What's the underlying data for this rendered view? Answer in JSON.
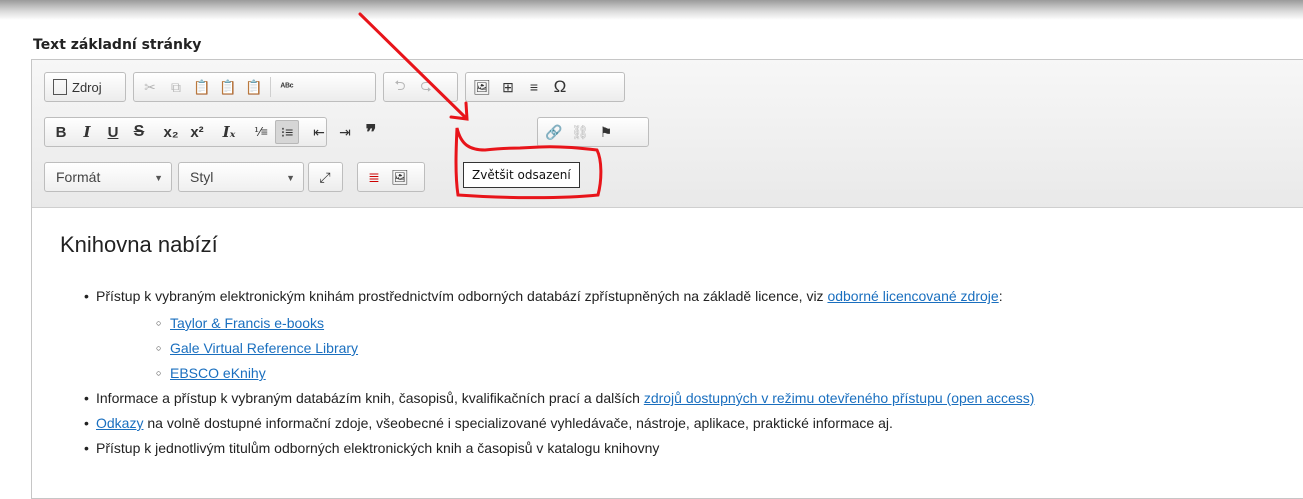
{
  "field_label": "Text základní stránky",
  "toolbar": {
    "source_label": "Zdroj",
    "format_combo": "Formát",
    "style_combo": "Styl",
    "tooltip": "Zvětšit odsazení"
  },
  "content": {
    "heading": "Knihovna nabízí",
    "items": [
      {
        "text": "Přístup k vybraným elektronickým knihám prostřednictvím odborných databází zpřístupněných na základě licence, viz ",
        "link": "odborné licencované zdroje",
        "suffix": ":",
        "sub": [
          "Taylor & Francis e-books",
          "Gale Virtual Reference Library",
          "EBSCO eKnihy"
        ]
      },
      {
        "text": "Informace a přístup k vybraným databázím knih, časopisů, kvalifikačních prací a dalších ",
        "link": "zdrojů dostupných v režimu otevřeného přístupu (open access)"
      },
      {
        "link": "Odkazy",
        "text": " na volně dostupné informační zdoje, všeobecné i specializované vyhledávače, nástroje, aplikace, praktické informace aj."
      },
      {
        "text": "Přístup k jednotlivým titulům odborných elektronických knih a časopisů v katalogu knihovny"
      }
    ]
  },
  "colors": {
    "link": "#1a6fbf",
    "annotation_red": "#e8141a"
  }
}
